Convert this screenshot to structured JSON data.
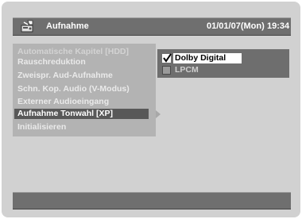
{
  "header": {
    "icon": "dvd-recorder-icon",
    "title": "Aufnahme",
    "date": "01/01/07(Mon)",
    "time": "19:34"
  },
  "menu": {
    "items": [
      {
        "label": "Automatische Kapitel [HDD]",
        "state": "disabled"
      },
      {
        "label": "Rauschreduktion",
        "state": "normal"
      },
      {
        "label": "Zweispr. Aud-Aufnahme",
        "state": "normal"
      },
      {
        "label": "Schn. Kop. Audio (V-Modus)",
        "state": "normal"
      },
      {
        "label": "Externer Audioeingang",
        "state": "normal"
      },
      {
        "label": "Aufnahme Tonwahl [XP]",
        "state": "selected"
      },
      {
        "label": "Initialisieren",
        "state": "normal"
      }
    ]
  },
  "submenu": {
    "options": [
      {
        "label": "Dolby Digital",
        "checked": true
      },
      {
        "label": "LPCM",
        "checked": false
      }
    ]
  },
  "colors": {
    "background": "#d1d1d1",
    "bar": "#6f6f6f",
    "menu": "#b3b3b3",
    "selected": "#585858",
    "submenu": "#6e6e6e"
  }
}
